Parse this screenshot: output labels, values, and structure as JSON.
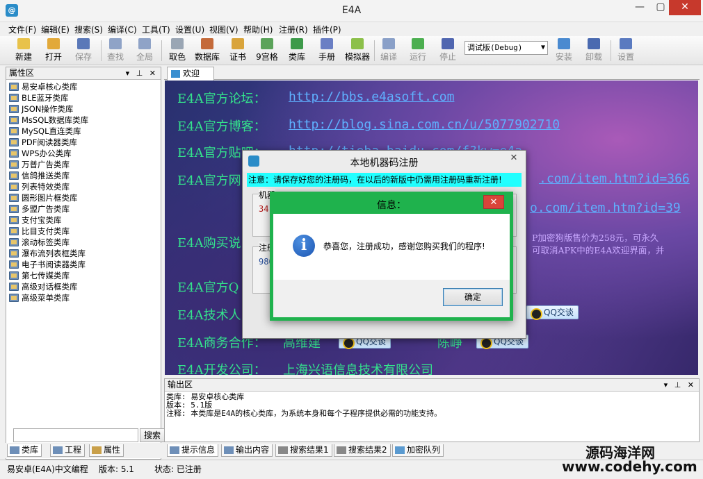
{
  "window": {
    "title": "E4A",
    "minimize": "—",
    "maximize": "▢",
    "close": "✕",
    "app_icon": "@"
  },
  "menu": [
    "文件(F)",
    "编辑(E)",
    "搜索(S)",
    "编译(C)",
    "工具(T)",
    "设置(U)",
    "视图(V)",
    "帮助(H)",
    "注册(R)",
    "插件(P)"
  ],
  "toolbar": {
    "new": "新建",
    "open": "打开",
    "save": "保存",
    "find": "查找",
    "global": "全局",
    "color": "取色",
    "database": "数据库",
    "cert": "证书",
    "grid9": "9宫格",
    "library": "类库",
    "manual": "手册",
    "emulator": "模拟器",
    "compile": "编译",
    "run": "运行",
    "stop": "停止",
    "build_mode": "调试版(Debug)",
    "install": "安装",
    "uninstall": "卸载",
    "settings": "设置"
  },
  "left_panel": {
    "title": "属性区",
    "controls": "▾ ⊥ ✕",
    "items": [
      "易安卓核心类库",
      "BLE蓝牙类库",
      "JSON操作类库",
      "MsSQL数据库类库",
      "MySQL直连类库",
      "PDF阅读器类库",
      "WPS办公类库",
      "万普广告类库",
      "信鸽推送类库",
      "列表特效类库",
      "圆形图片框类库",
      "多盟广告类库",
      "支付宝类库",
      "比目支付类库",
      "滚动标签类库",
      "瀑布流列表框类库",
      "电子书阅读器类库",
      "第七传媒类库",
      "高级对话框类库",
      "高级菜单类库"
    ],
    "search_button": "搜索",
    "tabs": [
      "类库",
      "工程",
      "属性"
    ]
  },
  "doc_tab": "欢迎",
  "welcome": {
    "forum_label": "E4A官方论坛：",
    "forum_url": "http://bbs.e4asoft.com",
    "blog_label": "E4A官方博客：",
    "blog_url": "http://blog.sina.com.cn/u/5077902710",
    "tieba_label": "E4A官方贴吧：",
    "tieba_url": "http://tieba.baidu.com/f?kw=e4a",
    "shop_label": "E4A官方网",
    "shop_url1": ".com/item.htm?id=366",
    "shop_url2": "o.com/item.htm?id=39",
    "buy_label": "E4A购买说",
    "buy_note1": "P加密狗版售价为258元，可永久",
    "buy_note2": "可取消APK中的E4A欢迎界面，并",
    "qq_label": "E4A官方Q",
    "tech_label": "E4A技术人",
    "biz_label": "E4A商务合作：",
    "biz_person1": "高维建",
    "biz_person2": "陈峥",
    "dev_label": "E4A开发公司：",
    "dev_company": "上海兴语信息技术有限公司",
    "qq_button": "QQ交谈"
  },
  "output": {
    "title": "输出区",
    "controls": "▾ ⊥ ✕",
    "lines": [
      "类库: 易安卓核心类库",
      "版本: 5.1版",
      "注释: 本类库是E4A的核心类库，为系统本身和每个子程序提供必需的功能支持。"
    ],
    "tabs": [
      "提示信息",
      "输出内容",
      "搜索结果1",
      "搜索结果2",
      "加密队列"
    ]
  },
  "status": {
    "app": "易安卓(E4A)中文编程",
    "version": "版本: 5.1",
    "state": "状态: 已注册"
  },
  "watermark": {
    "line1": "源码海洋网",
    "line2": "www.codehy.com"
  },
  "reg_dialog": {
    "title": "本地机器码注册",
    "close": "✕",
    "warning": "注意：请保存好您的注册码，在以后的新版中仍需用注册码重新注册!",
    "machine_label": "机器",
    "machine_value": "34",
    "reg_label": "注册",
    "reg_value": "980"
  },
  "msg_dialog": {
    "title": "信息：",
    "close": "✕",
    "text": "恭喜您，注册成功，感谢您购买我们的程序!",
    "ok": "确定",
    "icon": "i"
  }
}
